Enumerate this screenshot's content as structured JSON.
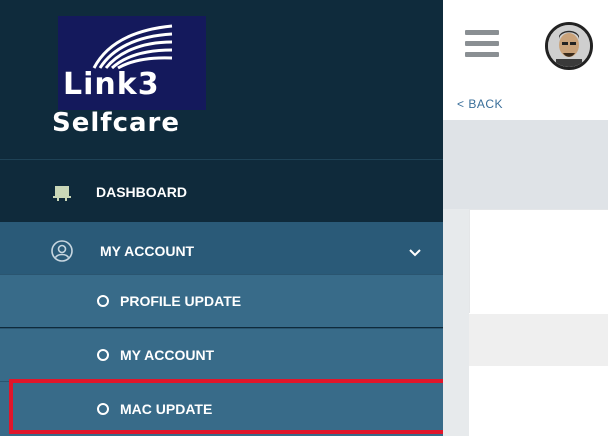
{
  "brand": {
    "logo_text": "Link3",
    "subtitle": "Selfcare"
  },
  "sidebar": {
    "items": [
      {
        "label": "DASHBOARD",
        "icon": "dashboard-icon"
      },
      {
        "label": "MY ACCOUNT",
        "icon": "user-icon",
        "expanded": true
      }
    ],
    "subitems": [
      {
        "label": "PROFILE UPDATE"
      },
      {
        "label": "MY ACCOUNT"
      },
      {
        "label": "MAC UPDATE",
        "highlighted": true
      }
    ]
  },
  "header": {
    "menu_icon": "hamburger-icon",
    "avatar": "avatar",
    "back_label": "< BACK"
  },
  "colors": {
    "sidebar_dark": "#0f2a3b",
    "active_section": "#2a5a78",
    "submenu": "#386b89",
    "highlight": "#e0162b",
    "logo_bg": "#14195c",
    "link": "#3a6f9a"
  }
}
